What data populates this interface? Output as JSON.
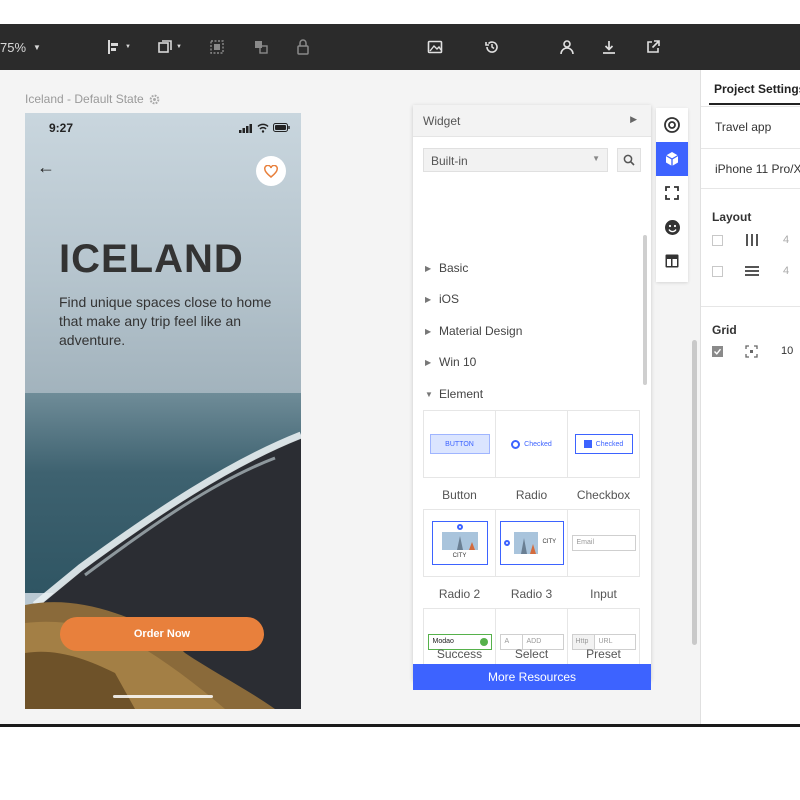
{
  "toolbar": {
    "zoom": "75%",
    "icons": [
      "align-left-icon",
      "arrange-icon",
      "group-icon",
      "ungroup-icon",
      "lock-icon",
      "image-icon",
      "history-icon",
      "user-icon",
      "download-icon",
      "share-icon"
    ]
  },
  "canvas": {
    "frame_label": "Iceland - Default State"
  },
  "phone": {
    "time": "9:27",
    "title": "ICELAND",
    "subtitle": "Find unique spaces close to home that make any trip feel like an adventure.",
    "cta": "Order Now",
    "accent": "#e8803c"
  },
  "widget_panel": {
    "header": "Widget",
    "library": "Built-in",
    "categories": [
      "Basic",
      "iOS",
      "Material Design",
      "Win 10",
      "Element"
    ],
    "previews": {
      "button": "BUTTON",
      "radio": "Checked",
      "checkbox": "Checked",
      "city": "CITY",
      "email_placeholder": "Email",
      "success_value": "Modao",
      "select_value": "A",
      "select_add": "ADD",
      "preset_prefix": "Http",
      "preset_placeholder": "URL"
    },
    "elements": [
      "Button",
      "Radio",
      "Checkbox",
      "Radio 2",
      "Radio 3",
      "Input",
      "Success",
      "Select",
      "Preset"
    ],
    "more": "More Resources",
    "accent": "#3d63ff"
  },
  "right_panel": {
    "tab": "Project Settings",
    "project_name": "Travel app",
    "device": "iPhone 11 Pro/X",
    "layout_heading": "Layout",
    "layout_values": [
      "4",
      "4"
    ],
    "grid_heading": "Grid",
    "grid_value": "10"
  }
}
